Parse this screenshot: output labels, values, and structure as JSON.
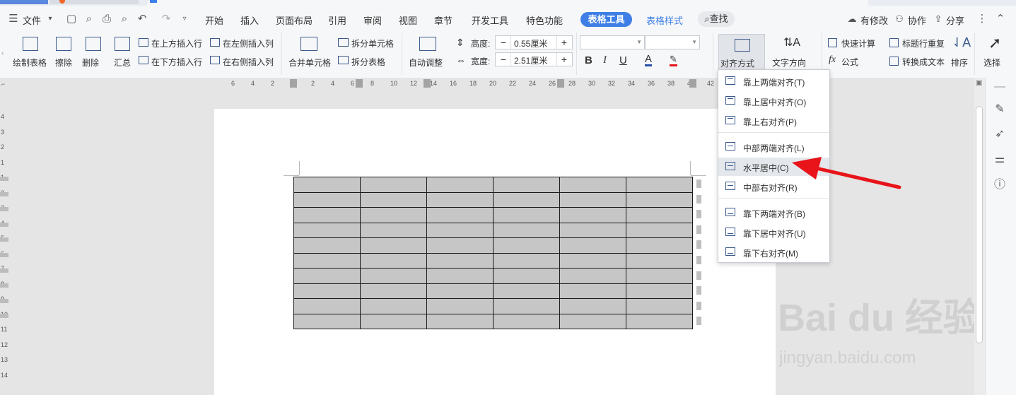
{
  "menubar": {
    "file_label": "文件",
    "tabs": [
      "开始",
      "插入",
      "页面布局",
      "引用",
      "审阅",
      "视图",
      "章节",
      "开发工具",
      "特色功能"
    ],
    "active_tab": "表格工具",
    "extra_tab": "表格样式",
    "search_label": "查找",
    "right": {
      "changes": "有修改",
      "collab": "协作",
      "share": "分享"
    }
  },
  "ribbon": {
    "draw_table": "绘制表格",
    "erase": "擦除",
    "delete": "删除",
    "summary": "汇总",
    "insert_above": "在上方插入行",
    "insert_below": "在下方插入行",
    "insert_left": "在左侧插入列",
    "insert_right": "在右侧插入列",
    "merge_cells": "合并单元格",
    "split_cells": "拆分单元格",
    "split_table": "拆分表格",
    "auto_fit": "自动调整",
    "height_label": "高度:",
    "height_value": "0.55厘米",
    "width_label": "宽度:",
    "width_value": "2.51厘米",
    "align": "对齐方式",
    "text_direction": "文字方向",
    "quick_calc": "快速计算",
    "formula": "公式",
    "formula_prefix": "fx",
    "repeat_header": "标题行重复",
    "to_text": "转换成文本",
    "sort": "排序",
    "select": "选择",
    "font_buttons": [
      "B",
      "I",
      "U",
      "A"
    ]
  },
  "ruler": {
    "top_ticks": [
      "6",
      "4",
      "2",
      "2",
      "4",
      "6",
      "8",
      "10",
      "12",
      "14",
      "16",
      "18",
      "20",
      "22",
      "24",
      "26",
      "28",
      "30",
      "32",
      "34",
      "36",
      "38",
      "40",
      "42"
    ],
    "left_ticks": [
      "4",
      "3",
      "2",
      "1",
      "1",
      "2",
      "3",
      "4",
      "5",
      "6",
      "7",
      "8",
      "9",
      "10",
      "11",
      "12",
      "13",
      "14"
    ]
  },
  "table": {
    "rows": 10,
    "cols": 6
  },
  "dropdown": {
    "items": [
      {
        "label": "靠上两端对齐(T)",
        "pos": "top"
      },
      {
        "label": "靠上居中对齐(O)",
        "pos": "top"
      },
      {
        "label": "靠上右对齐(P)",
        "pos": "top"
      },
      {
        "label": "中部两端对齐(L)",
        "pos": "mid"
      },
      {
        "label": "水平居中(C)",
        "pos": "mid",
        "highlighted": true
      },
      {
        "label": "中部右对齐(R)",
        "pos": "mid"
      },
      {
        "label": "靠下两端对齐(B)",
        "pos": "bot"
      },
      {
        "label": "靠下居中对齐(U)",
        "pos": "bot"
      },
      {
        "label": "靠下右对齐(M)",
        "pos": "bot"
      }
    ]
  },
  "watermark": {
    "brand": "Bai du 经验",
    "url": "jingyan.baidu.com"
  },
  "colors": {
    "accent": "#3f7fe5",
    "arrow": "#e8141a",
    "table_fill": "#c6c6c6"
  }
}
